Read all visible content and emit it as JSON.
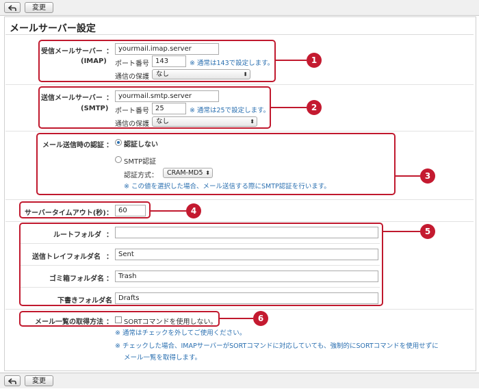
{
  "toolbar": {
    "back_icon": "back-arrow-icon",
    "change_label": "変更"
  },
  "title": "メールサーバー設定",
  "incoming": {
    "label": "受信メールサーバー",
    "sublabel": "(IMAP)",
    "server": "yourmail.imap.server",
    "port_label": "ポート番号",
    "port": "143",
    "port_note": "※ 通常は143で設定します。",
    "protect_label": "通信の保護",
    "protect_value": "なし"
  },
  "outgoing": {
    "label": "送信メールサーバー",
    "sublabel": "(SMTP)",
    "server": "yourmail.smtp.server",
    "port_label": "ポート番号",
    "port": "25",
    "port_note": "※ 通常は25で設定します。",
    "protect_label": "通信の保護",
    "protect_value": "なし"
  },
  "auth": {
    "label": "メール送信時の認証",
    "option_none": "認証しない",
    "option_smtp": "SMTP認証",
    "method_label": "認証方式：",
    "method_value": "CRAM-MD5",
    "note": "※ この値を選択した場合、メール送信する際にSMTP認証を行います。"
  },
  "timeout": {
    "label": "サーバータイムアウト(秒)",
    "value": "60"
  },
  "folders": {
    "root_label": "ルートフォルダ",
    "root_value": "",
    "sent_label": "送信トレイフォルダ名",
    "sent_value": "Sent",
    "trash_label": "ゴミ箱フォルダ名",
    "trash_value": "Trash",
    "drafts_label": "下書きフォルダ名",
    "drafts_value": "Drafts"
  },
  "listing": {
    "label": "メール一覧の取得方法",
    "checkbox_label": "SORTコマンドを使用しない。",
    "note1": "※ 通常はチェックを外してご使用ください。",
    "note2": "※ チェックした場合、IMAPサーバーがSORTコマンドに対応していても、強制的にSORTコマンドを使用せずに",
    "note3": "メール一覧を取得します。"
  },
  "colon": "：",
  "callouts": [
    "1",
    "2",
    "3",
    "4",
    "5",
    "6"
  ],
  "colors": {
    "highlight": "#c0182d",
    "note": "#2a6fb0",
    "callout": "#c41a30"
  }
}
